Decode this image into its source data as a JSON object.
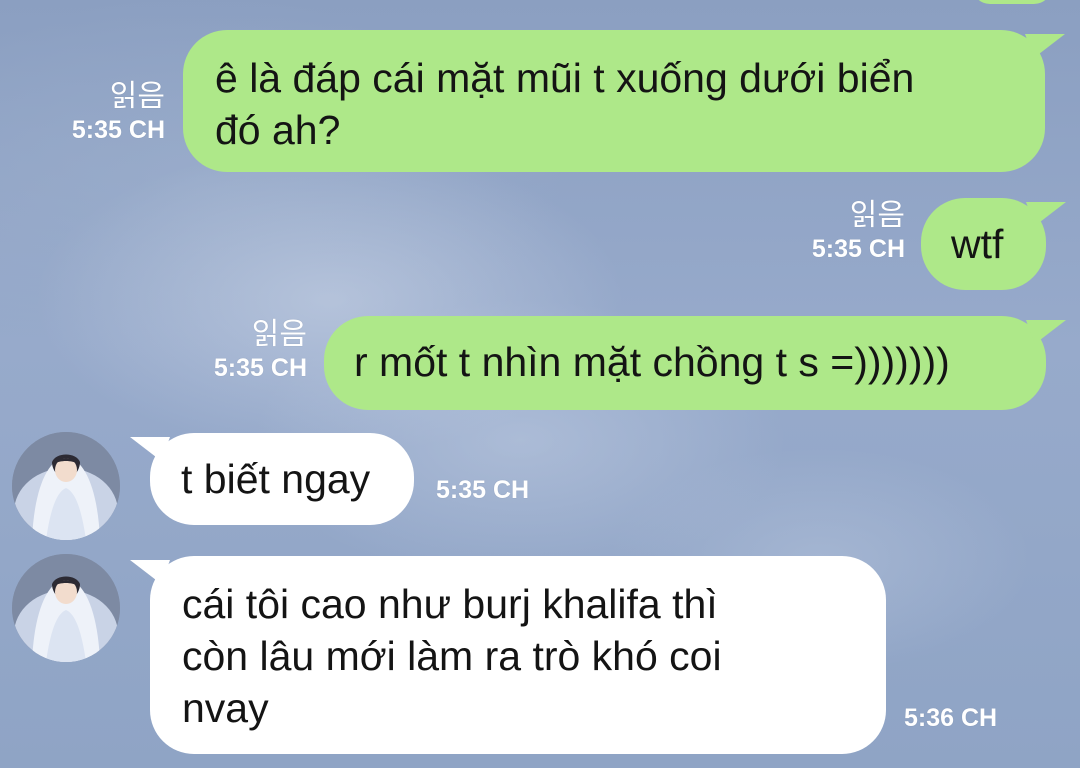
{
  "chat": {
    "messages": [
      {
        "side": "sent",
        "lines": [
          "ê là đáp cái mặt mũi t xuống dưới biển",
          "đó ah?"
        ],
        "read": "읽음",
        "time": "5:35 CH"
      },
      {
        "side": "sent",
        "lines": [
          "wtf"
        ],
        "read": "읽음",
        "time": "5:35 CH"
      },
      {
        "side": "sent",
        "lines": [
          "r mốt t nhìn mặt chồng t s =)))))))"
        ],
        "read": "읽음",
        "time": "5:35 CH"
      },
      {
        "side": "received",
        "lines": [
          "t biết ngay"
        ],
        "time": "5:35 CH"
      },
      {
        "side": "received",
        "lines": [
          "cái tôi cao như burj khalifa thì",
          "còn lâu mới làm ra trò khó coi",
          "nvay"
        ],
        "time": "5:36 CH"
      }
    ]
  },
  "colors": {
    "sent_bubble": "#aee889",
    "received_bubble": "#ffffff",
    "background": "#8ea3c4",
    "meta_text": "#ffffff"
  },
  "icons": {
    "avatar": "contact-avatar-photo"
  }
}
